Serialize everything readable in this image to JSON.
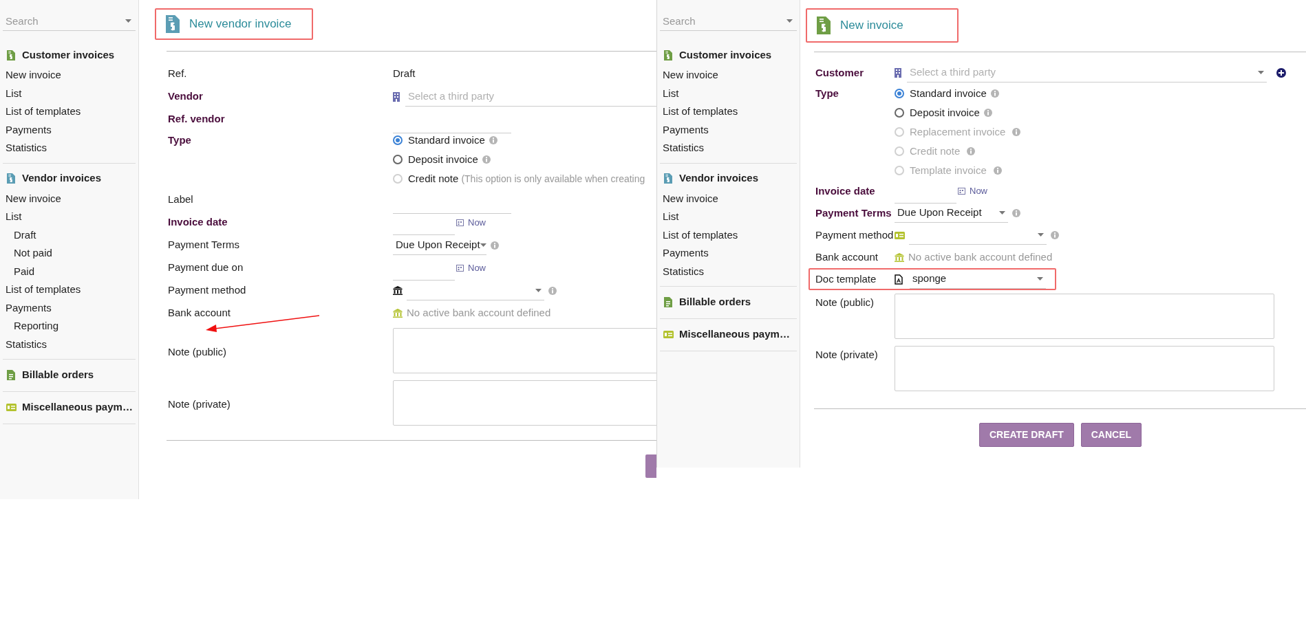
{
  "screens": [
    {
      "search": {
        "placeholder": "Search"
      },
      "sidebar": [
        {
          "title": "Customer invoices",
          "items": [
            {
              "label": "New invoice"
            },
            {
              "label": "List"
            },
            {
              "label": "List of templates"
            },
            {
              "label": "Payments"
            },
            {
              "label": "Statistics"
            }
          ]
        },
        {
          "title": "Vendor invoices",
          "items": [
            {
              "label": "New invoice"
            },
            {
              "label": "List",
              "children": [
                {
                  "label": "Draft"
                },
                {
                  "label": "Not paid"
                },
                {
                  "label": "Paid"
                }
              ]
            },
            {
              "label": "List of templates"
            },
            {
              "label": "Payments",
              "children": [
                {
                  "label": "Reporting"
                }
              ]
            },
            {
              "label": "Statistics"
            }
          ]
        },
        {
          "title": "Billable orders"
        },
        {
          "title": "Miscellaneous paym…"
        }
      ],
      "header": {
        "title": "New vendor invoice",
        "highlighted": true
      },
      "form": [
        {
          "kind": "text",
          "label": "Ref.",
          "required": false,
          "value": "Draft"
        },
        {
          "kind": "party",
          "label": "Vendor",
          "required": true,
          "placeholder": "Select a third party",
          "add_button": false
        },
        {
          "kind": "input",
          "label": "Ref. vendor",
          "required": true
        },
        {
          "kind": "radio",
          "label": "Type",
          "required": true,
          "options": [
            {
              "label": "Standard invoice",
              "selected": true,
              "disabled": false,
              "info": true
            },
            {
              "label": "Deposit invoice",
              "selected": false,
              "disabled": false,
              "info": true
            },
            {
              "label": "Credit note",
              "hint": "(This option is only available when creating",
              "selected": false,
              "disabled": true,
              "info": false
            }
          ]
        },
        {
          "kind": "input",
          "label": "Label",
          "required": false
        },
        {
          "kind": "date",
          "label": "Invoice date",
          "required": true,
          "now": "Now"
        },
        {
          "kind": "select",
          "label": "Payment Terms",
          "required": false,
          "value": "Due Upon Receipt",
          "info": true
        },
        {
          "kind": "date",
          "label": "Payment due on",
          "required": false,
          "now": "Now"
        },
        {
          "kind": "method_select",
          "label": "Payment method",
          "required": false,
          "info": true
        },
        {
          "kind": "note",
          "label": "Bank account",
          "required": false,
          "text": "No active bank account defined"
        },
        {
          "kind": "textarea",
          "label": "Note (public)",
          "required": false
        },
        {
          "kind": "textarea",
          "label": "Note (private)",
          "required": false
        }
      ],
      "buttons": [
        {
          "kind": "cut"
        }
      ]
    },
    {
      "search": {
        "placeholder": "Search"
      },
      "sidebar": [
        {
          "title": "Customer invoices",
          "items": [
            {
              "label": "New invoice"
            },
            {
              "label": "List"
            },
            {
              "label": "List of templates"
            },
            {
              "label": "Payments"
            },
            {
              "label": "Statistics"
            }
          ]
        },
        {
          "title": "Vendor invoices",
          "items": [
            {
              "label": "New invoice"
            },
            {
              "label": "List"
            },
            {
              "label": "List of templates"
            },
            {
              "label": "Payments"
            },
            {
              "label": "Statistics"
            }
          ]
        },
        {
          "title": "Billable orders"
        },
        {
          "title": "Miscellaneous paym…"
        }
      ],
      "header": {
        "title": "New invoice",
        "highlighted": true
      },
      "form": [
        {
          "kind": "party",
          "label": "Customer",
          "required": true,
          "placeholder": "Select a third party",
          "add_button": true
        },
        {
          "kind": "radio",
          "label": "Type",
          "required": true,
          "options": [
            {
              "label": "Standard invoice",
              "selected": true,
              "disabled": false,
              "info": true
            },
            {
              "label": "Deposit invoice",
              "selected": false,
              "disabled": false,
              "info": true
            },
            {
              "label": "Replacement invoice",
              "selected": false,
              "disabled": true,
              "info": true
            },
            {
              "label": "Credit note",
              "selected": false,
              "disabled": true,
              "info": true
            },
            {
              "label": "Template invoice",
              "selected": false,
              "disabled": true,
              "info": true
            }
          ]
        },
        {
          "kind": "date",
          "label": "Invoice date",
          "required": true,
          "now": "Now"
        },
        {
          "kind": "select",
          "label": "Payment Terms",
          "required": true,
          "value": "Due Upon Receipt",
          "info": true
        },
        {
          "kind": "method_select",
          "label": "Payment method",
          "required": false,
          "info": true
        },
        {
          "kind": "note",
          "label": "Bank account",
          "required": false,
          "text": "No active bank account defined"
        },
        {
          "kind": "template_select",
          "label": "Doc template",
          "required": false,
          "value": "sponge",
          "highlighted": true
        },
        {
          "kind": "textarea",
          "label": "Note (public)",
          "required": false
        },
        {
          "kind": "textarea",
          "label": "Note (private)",
          "required": false
        }
      ],
      "buttons": [
        {
          "kind": "button",
          "label": "CREATE DRAFT"
        },
        {
          "kind": "button",
          "label": "CANCEL"
        }
      ]
    }
  ]
}
